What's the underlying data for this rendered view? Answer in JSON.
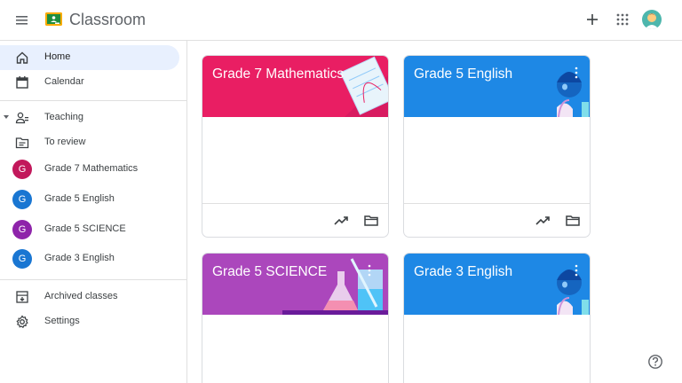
{
  "app": {
    "title": "Classroom"
  },
  "colors": {
    "accent_blue": "#1967d2",
    "active_bg": "#e8f0fe",
    "math_pink": "#e91e63",
    "english_blue": "#1e88e5",
    "science_purple": "#8e24aa"
  },
  "sidebar": {
    "home": "Home",
    "calendar": "Calendar",
    "teaching": "Teaching",
    "to_review": "To review",
    "classes": [
      {
        "initial": "G",
        "label": "Grade 7 Mathematics",
        "color": "#c2185b"
      },
      {
        "initial": "G",
        "label": "Grade 5 English",
        "color": "#1976d2"
      },
      {
        "initial": "G",
        "label": "Grade 5 SCIENCE",
        "color": "#8e24aa"
      },
      {
        "initial": "G",
        "label": "Grade 3 English",
        "color": "#1976d2"
      }
    ],
    "archived": "Archived classes",
    "settings": "Settings"
  },
  "cards": [
    {
      "title": "Grade 7 Mathematics",
      "theme": "math"
    },
    {
      "title": "Grade 5 English",
      "theme": "english"
    },
    {
      "title": "Grade 5 SCIENCE",
      "theme": "science"
    },
    {
      "title": "Grade 3 English",
      "theme": "english"
    }
  ],
  "icons": [
    "menu-icon",
    "classroom-logo-icon",
    "plus-icon",
    "apps-grid-icon",
    "avatar",
    "home-icon",
    "calendar-icon",
    "teaching-people-icon",
    "to-review-icon",
    "archive-icon",
    "settings-gear-icon",
    "trending-up-icon",
    "folder-icon",
    "more-vert-icon",
    "help-icon"
  ]
}
